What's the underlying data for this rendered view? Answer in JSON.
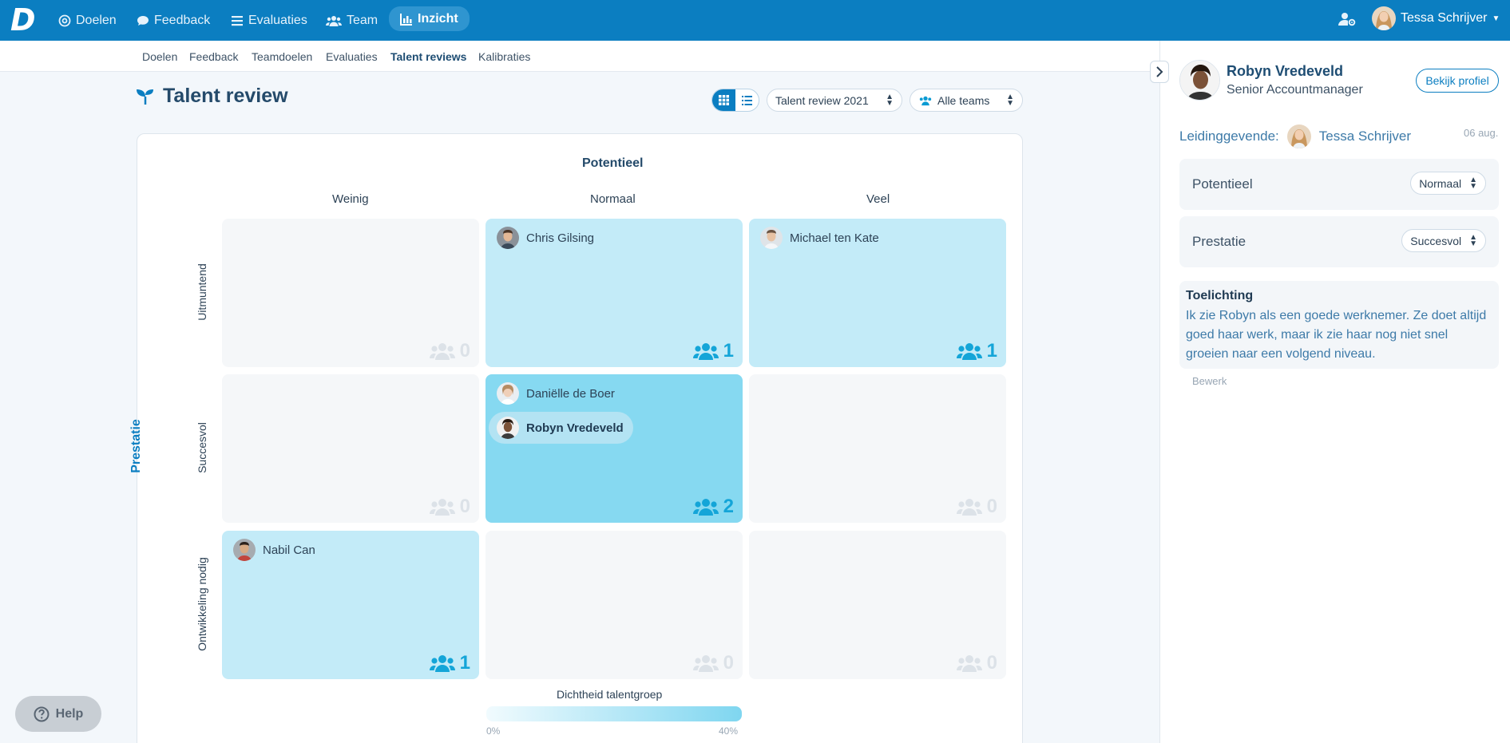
{
  "nav": {
    "items": [
      {
        "label": "Doelen",
        "icon": "target-icon"
      },
      {
        "label": "Feedback",
        "icon": "chat-icon"
      },
      {
        "label": "Evaluaties",
        "icon": "list-icon"
      },
      {
        "label": "Team",
        "icon": "users-icon"
      },
      {
        "label": "Inzicht",
        "icon": "chart-icon",
        "active": true
      }
    ],
    "user_name": "Tessa Schrijver",
    "accent": "#0b7ec1"
  },
  "subnav": {
    "items": [
      "Doelen",
      "Feedback",
      "Teamdoelen",
      "Evaluaties",
      "Talent reviews",
      "Kalibraties"
    ],
    "active": "Talent reviews"
  },
  "page": {
    "title": "Talent review",
    "review_select": "Talent review 2021",
    "team_select": "Alle teams"
  },
  "grid": {
    "potential_axis": "Potentieel",
    "performance_axis": "Prestatie",
    "columns": [
      "Weinig",
      "Normaal",
      "Veel"
    ],
    "rows": [
      "Uitmuntend",
      "Succesvol",
      "Ontwikkeling nodig"
    ],
    "cells": [
      {
        "count": "0",
        "people": []
      },
      {
        "count": "1",
        "people": [
          "Chris Gilsing"
        ]
      },
      {
        "count": "1",
        "people": [
          "Michael ten Kate"
        ]
      },
      {
        "count": "0",
        "people": []
      },
      {
        "count": "2",
        "people": [
          "Daniëlle de Boer",
          "Robyn Vredeveld"
        ]
      },
      {
        "count": "0",
        "people": []
      },
      {
        "count": "1",
        "people": [
          "Nabil Can"
        ]
      },
      {
        "count": "0",
        "people": []
      },
      {
        "count": "0",
        "people": []
      }
    ],
    "legend": {
      "title": "Dichtheid talentgroep",
      "min": "0%",
      "max": "40%"
    }
  },
  "help": {
    "label": "Help"
  },
  "panel": {
    "name": "Robyn Vredeveld",
    "role": "Senior Accountmanager",
    "profile_button": "Bekijk profiel",
    "manager_label": "Leidinggevende:",
    "manager_name": "Tessa Schrijver",
    "date": "06 aug.",
    "potential_label": "Potentieel",
    "potential_value": "Normaal",
    "performance_label": "Prestatie",
    "performance_value": "Succesvol",
    "note_title": "Toelichting",
    "note_text": "Ik zie Robyn als een goede werknemer. Ze doet altijd goed haar werk, maar ik zie haar nog niet snel groeien naar een volgend niveau.",
    "edit_label": "Bewerk"
  }
}
